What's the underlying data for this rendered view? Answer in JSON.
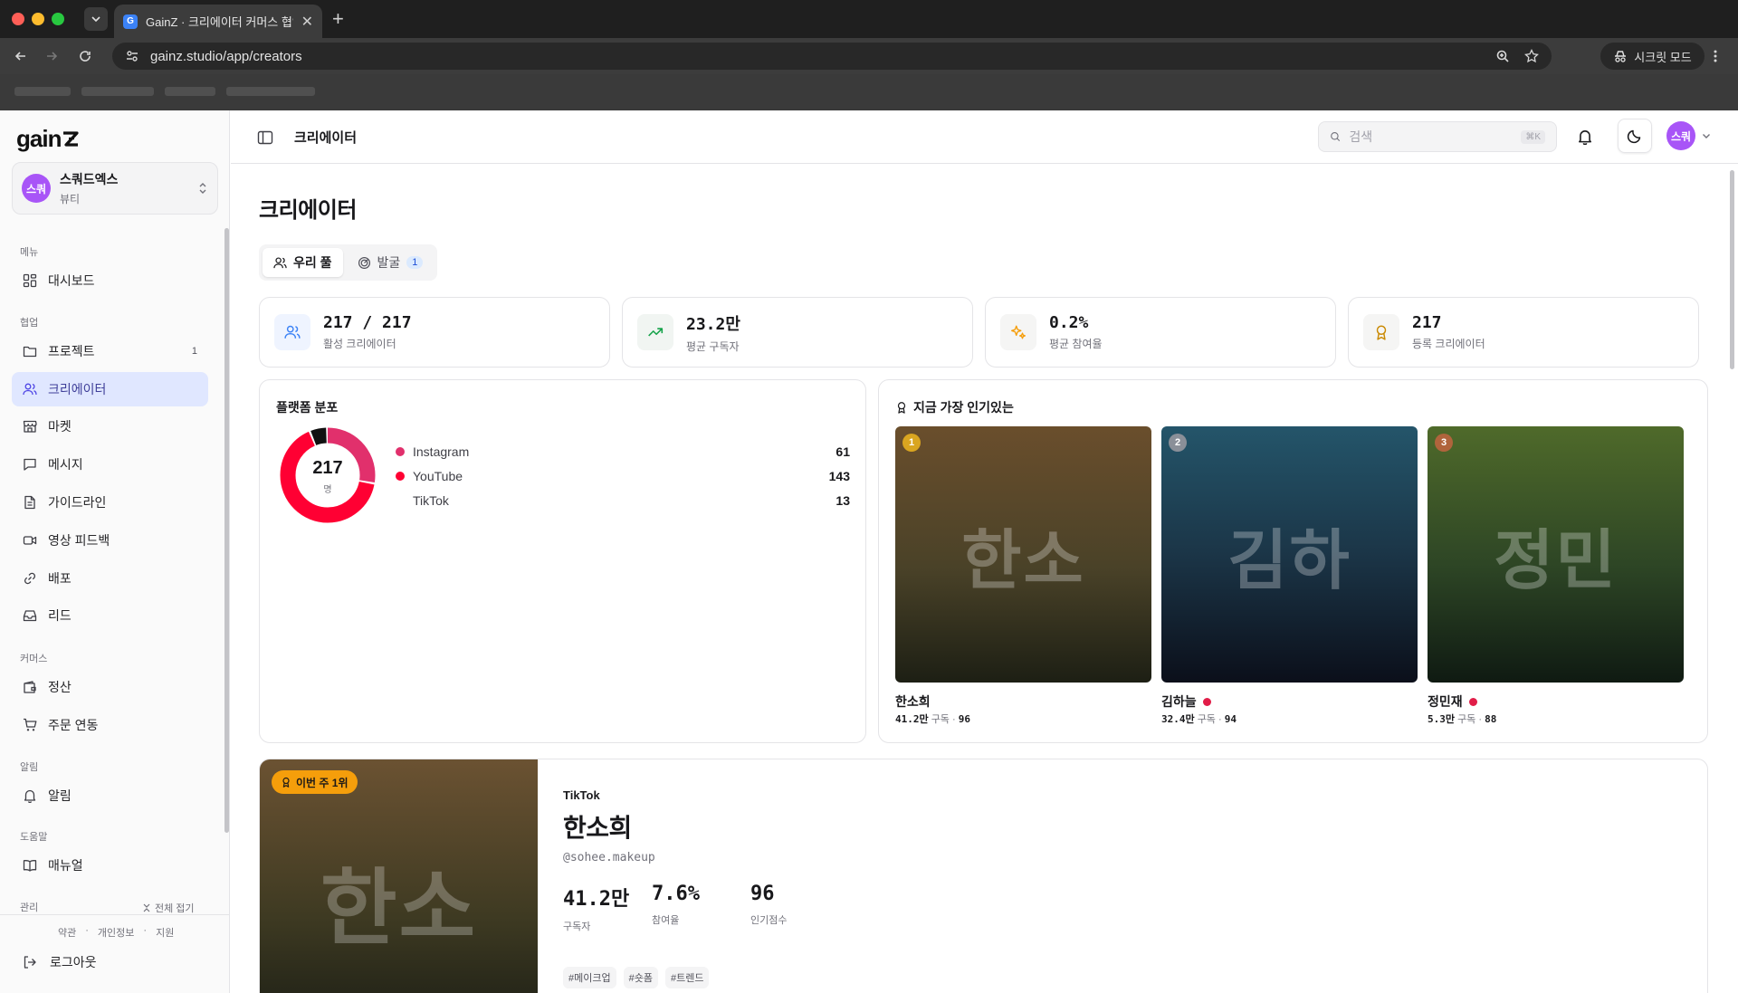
{
  "browser": {
    "tab_title": "GainZ · 크리에이터 커머스 협업 C",
    "favicon": "G",
    "url": "gainz.studio/app/creators",
    "incognito_label": "시크릿 모드"
  },
  "sidebar": {
    "logo": "gain",
    "workspace": {
      "avatar": "스쿼",
      "name": "스쿼드엑스",
      "category": "뷰티"
    },
    "sections": {
      "menu": "메뉴",
      "collab": "협업",
      "commerce": "커머스",
      "alerts": "알림",
      "help": "도움말",
      "admin": "관리"
    },
    "items": [
      {
        "label": "대시보드",
        "icon": "dashboard-icon"
      },
      {
        "label": "프로젝트",
        "icon": "folder-icon",
        "count": "1"
      },
      {
        "label": "크리에이터",
        "icon": "users-icon",
        "active": true
      },
      {
        "label": "마켓",
        "icon": "store-icon"
      },
      {
        "label": "메시지",
        "icon": "message-icon"
      },
      {
        "label": "가이드라인",
        "icon": "document-icon"
      },
      {
        "label": "영상 피드백",
        "icon": "video-icon"
      },
      {
        "label": "배포",
        "icon": "link-icon"
      },
      {
        "label": "리드",
        "icon": "inbox-icon"
      },
      {
        "label": "정산",
        "icon": "wallet-icon"
      },
      {
        "label": "주문 연동",
        "icon": "cart-icon"
      },
      {
        "label": "알림",
        "icon": "bell-icon"
      },
      {
        "label": "매뉴얼",
        "icon": "book-icon"
      }
    ],
    "collapse_all": "전체 접기",
    "footer_links": [
      "약관",
      "·",
      "개인정보",
      "·",
      "지원"
    ],
    "logout": "로그아웃"
  },
  "header": {
    "title": "크리에이터",
    "search_placeholder": "검색",
    "search_shortcut": "⌘K",
    "user_avatar": "스쿼"
  },
  "page": {
    "title": "크리에이터",
    "tabs": [
      {
        "label": "우리 풀",
        "active": true
      },
      {
        "label": "발굴",
        "badge": "1"
      }
    ],
    "stats": [
      {
        "value": "217 / 217",
        "label": "활성 크리에이터",
        "icon": "users-icon",
        "color": "#3b82f6"
      },
      {
        "value": "23.2만",
        "label": "평균 구독자",
        "icon": "trending-up-icon",
        "color": "#16a34a"
      },
      {
        "value": "0.2%",
        "label": "평균 참여율",
        "icon": "sparkles-icon",
        "color": "#f59e0b"
      },
      {
        "value": "217",
        "label": "등록 크리에이터",
        "icon": "award-icon",
        "color": "#ca8a04"
      }
    ],
    "platform": {
      "title": "플랫폼 분포",
      "total": "217",
      "unit": "명",
      "items": [
        {
          "name": "Instagram",
          "value": 61,
          "color": "#e1306c"
        },
        {
          "name": "YouTube",
          "value": 143,
          "color": "#ff0033"
        },
        {
          "name": "TikTok",
          "value": 13,
          "color": "#111111"
        }
      ]
    },
    "popular": {
      "title": "지금 가장 인기있는",
      "items": [
        {
          "rank": "1",
          "initials": "한소",
          "name": "한소희",
          "subs": "41.2만",
          "subs_label": "구독",
          "score": "96",
          "rank_color": "#d9a520",
          "live": false
        },
        {
          "rank": "2",
          "initials": "김하",
          "name": "김하늘",
          "subs": "32.4만",
          "subs_label": "구독",
          "score": "94",
          "rank_color": "#8a8f98",
          "live": true
        },
        {
          "rank": "3",
          "initials": "정민",
          "name": "정민재",
          "subs": "5.3만",
          "subs_label": "구독",
          "score": "88",
          "rank_color": "#b0643c",
          "live": true
        }
      ]
    },
    "featured": {
      "badge": "이번 주 1위",
      "initials": "한소",
      "platform": "TikTok",
      "name": "한소희",
      "handle": "@sohee.makeup",
      "stats": [
        {
          "value": "41.2만",
          "label": "구독자"
        },
        {
          "value": "7.6%",
          "label": "참여율"
        },
        {
          "value": "96",
          "label": "인기점수"
        }
      ],
      "tags": [
        "#메이크업",
        "#숏폼",
        "#트렌드"
      ]
    }
  }
}
